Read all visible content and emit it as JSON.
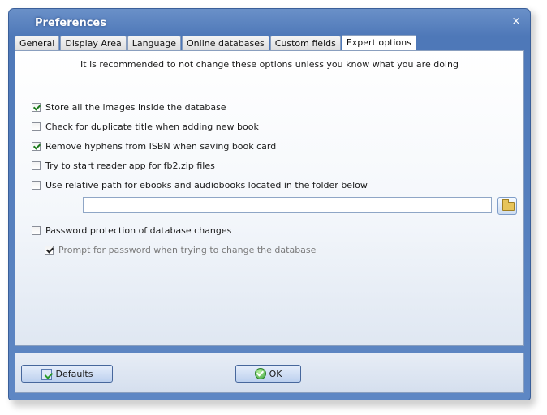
{
  "window": {
    "title": "Preferences",
    "close_glyph": "×"
  },
  "tabs": [
    {
      "label": "General"
    },
    {
      "label": "Display Area"
    },
    {
      "label": "Language"
    },
    {
      "label": "Online databases"
    },
    {
      "label": "Custom fields"
    },
    {
      "label": "Expert options",
      "active": true
    }
  ],
  "expert": {
    "notice": "It is recommended to not change these options unless you know what you are doing",
    "options": [
      {
        "label": "Store all the images inside the database",
        "checked": true
      },
      {
        "label": "Check for duplicate title when adding new book",
        "checked": false
      },
      {
        "label": "Remove hyphens from ISBN when saving book card",
        "checked": true
      },
      {
        "label": "Try to start reader app for fb2.zip files",
        "checked": false
      },
      {
        "label": "Use relative path for ebooks and audiobooks located in the folder below",
        "checked": false
      },
      {
        "label": "Password protection of database changes",
        "checked": false
      },
      {
        "label": "Prompt for password when trying to change the database",
        "checked": true,
        "disabled": true
      }
    ],
    "folder_path": ""
  },
  "footer": {
    "defaults_label": "Defaults",
    "ok_label": "OK"
  },
  "icons": {
    "close": "close-icon",
    "browse": "folder-icon",
    "defaults": "defaults-icon",
    "ok": "ok-check-icon"
  }
}
